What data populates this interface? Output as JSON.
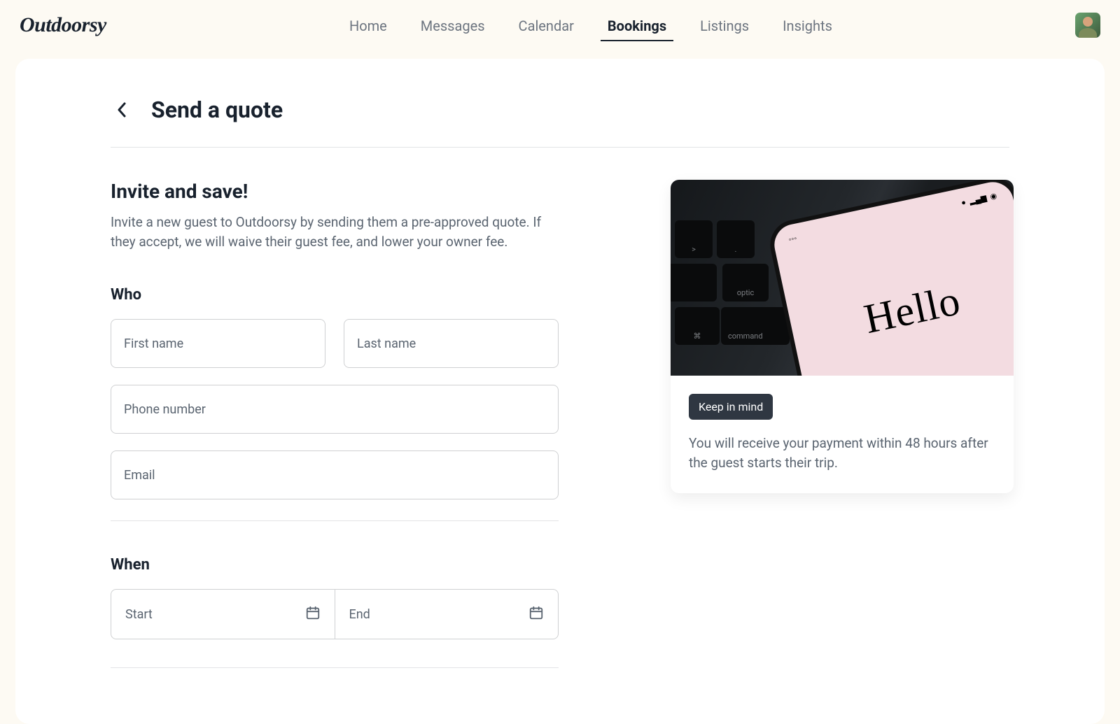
{
  "brand": "Outdoorsy",
  "nav": {
    "items": [
      "Home",
      "Messages",
      "Calendar",
      "Bookings",
      "Listings",
      "Insights"
    ],
    "active": "Bookings"
  },
  "page": {
    "title": "Send a quote"
  },
  "intro": {
    "heading": "Invite and save!",
    "body": "Invite a new guest to Outdoorsy by sending them a pre-approved quote. If they accept, we will waive their guest fee, and lower your owner fee."
  },
  "who": {
    "section_label": "Who",
    "first_name_placeholder": "First name",
    "last_name_placeholder": "Last name",
    "phone_placeholder": "Phone number",
    "email_placeholder": "Email"
  },
  "when": {
    "section_label": "When",
    "start_placeholder": "Start",
    "end_placeholder": "End"
  },
  "info_card": {
    "hero_word": "Hello",
    "badge": "Keep in mind",
    "text": "You will receive your payment within 48 hours after the guest starts their trip."
  }
}
